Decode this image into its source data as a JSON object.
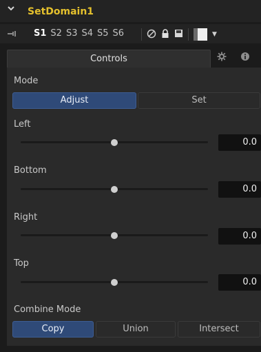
{
  "header": {
    "title": "SetDomain1"
  },
  "toolbar": {
    "slots": [
      "S1",
      "S2",
      "S3",
      "S4",
      "S5",
      "S6"
    ],
    "active_slot": "S1"
  },
  "tabs": {
    "controls_label": "Controls"
  },
  "mode": {
    "label": "Mode",
    "options": [
      "Adjust",
      "Set"
    ],
    "selected": "Adjust"
  },
  "params": [
    {
      "label": "Left",
      "value": "0.0",
      "slider_fraction": 0.5
    },
    {
      "label": "Bottom",
      "value": "0.0",
      "slider_fraction": 0.5
    },
    {
      "label": "Right",
      "value": "0.0",
      "slider_fraction": 0.5
    },
    {
      "label": "Top",
      "value": "0.0",
      "slider_fraction": 0.5
    }
  ],
  "combine_mode": {
    "label": "Combine Mode",
    "options": [
      "Copy",
      "Union",
      "Intersect"
    ],
    "selected": "Copy"
  },
  "colors": {
    "title": "#e5c12d",
    "active_button": "#2f4a78",
    "panel_bg": "#2a2a2a"
  }
}
